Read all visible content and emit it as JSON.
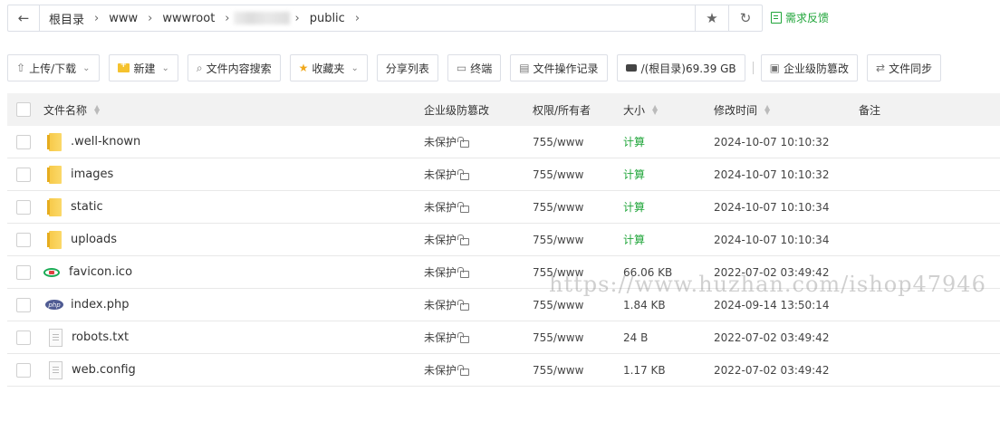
{
  "path": {
    "crumbs": [
      "根目录",
      "www",
      "wwwroot",
      "public"
    ],
    "back_icon": "arrow-left-icon",
    "star_icon": "star-icon",
    "refresh_icon": "refresh-icon"
  },
  "feedback": {
    "label": "需求反馈",
    "color": "#20a53a"
  },
  "toolbar": {
    "upload_label": "上传/下载",
    "new_label": "新建",
    "search_label": "文件内容搜索",
    "favorites_label": "收藏夹",
    "share_label": "分享列表",
    "terminal_label": "终端",
    "oplog_label": "文件操作记录",
    "disk_label": "/(根目录)69.39 GB",
    "tamper_label": "企业级防篡改",
    "sync_label": "文件同步"
  },
  "table": {
    "headers": {
      "name": "文件名称",
      "tamper": "企业级防篡改",
      "perm": "权限/所有者",
      "size": "大小",
      "mtime": "修改时间",
      "note": "备注"
    },
    "rows": [
      {
        "name": ".well-known",
        "icon": "folder-icon",
        "tamper": "未保护",
        "perm": "755/www",
        "size": "计算",
        "mtime": "2024-10-07 10:10:32",
        "note": ""
      },
      {
        "name": "images",
        "icon": "folder-icon",
        "tamper": "未保护",
        "perm": "755/www",
        "size": "计算",
        "mtime": "2024-10-07 10:10:32",
        "note": ""
      },
      {
        "name": "static",
        "icon": "folder-icon",
        "tamper": "未保护",
        "perm": "755/www",
        "size": "计算",
        "mtime": "2024-10-07 10:10:34",
        "note": ""
      },
      {
        "name": "uploads",
        "icon": "folder-icon",
        "tamper": "未保护",
        "perm": "755/www",
        "size": "计算",
        "mtime": "2024-10-07 10:10:34",
        "note": ""
      },
      {
        "name": "favicon.ico",
        "icon": "ico-file-icon",
        "tamper": "未保护",
        "perm": "755/www",
        "size": "66.06 KB",
        "mtime": "2022-07-02 03:49:42",
        "note": ""
      },
      {
        "name": "index.php",
        "icon": "php-file-icon",
        "tamper": "未保护",
        "perm": "755/www",
        "size": "1.84 KB",
        "mtime": "2024-09-14 13:50:14",
        "note": ""
      },
      {
        "name": "robots.txt",
        "icon": "text-file-icon",
        "tamper": "未保护",
        "perm": "755/www",
        "size": "24 B",
        "mtime": "2022-07-02 03:49:42",
        "note": ""
      },
      {
        "name": "web.config",
        "icon": "text-file-icon",
        "tamper": "未保护",
        "perm": "755/www",
        "size": "1.17 KB",
        "mtime": "2022-07-02 03:49:42",
        "note": ""
      }
    ]
  },
  "watermark": "https://www.huzhan.com/ishop47946"
}
